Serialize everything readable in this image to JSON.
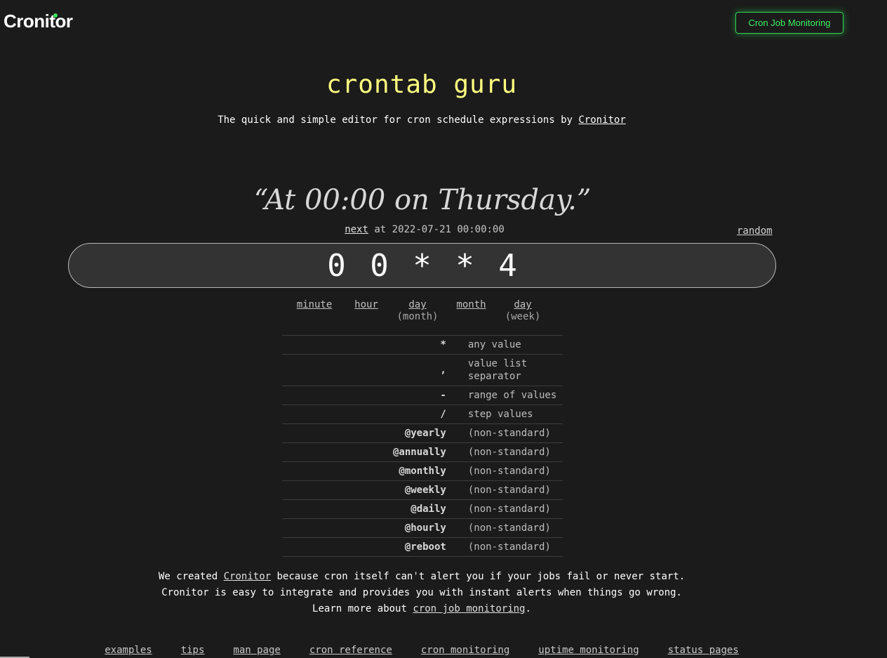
{
  "header": {
    "logo": "Cronitor",
    "cta_label": "Cron Job Monitoring"
  },
  "hero": {
    "title": "crontab guru",
    "subtitle_prefix": "The quick and simple editor for cron schedule expressions by ",
    "subtitle_link": "Cronitor"
  },
  "editor": {
    "human_readable": "“At 00:00 on Thursday.”",
    "next_label": "next",
    "next_text": " at 2022-07-21 00:00:00",
    "random_label": "random",
    "expression": "0 0 * * 4"
  },
  "parts": [
    {
      "label": "minute",
      "sub": ""
    },
    {
      "label": "hour",
      "sub": ""
    },
    {
      "label": "day",
      "sub": "(month)"
    },
    {
      "label": "month",
      "sub": ""
    },
    {
      "label": "day",
      "sub": "(week)"
    }
  ],
  "legend": [
    {
      "symbol": "*",
      "description": "any value"
    },
    {
      "symbol": ",",
      "description": "value list separator"
    },
    {
      "symbol": "-",
      "description": "range of values"
    },
    {
      "symbol": "/",
      "description": "step values"
    },
    {
      "symbol": "@yearly",
      "description": "(non-standard)"
    },
    {
      "symbol": "@annually",
      "description": "(non-standard)"
    },
    {
      "symbol": "@monthly",
      "description": "(non-standard)"
    },
    {
      "symbol": "@weekly",
      "description": "(non-standard)"
    },
    {
      "symbol": "@daily",
      "description": "(non-standard)"
    },
    {
      "symbol": "@hourly",
      "description": "(non-standard)"
    },
    {
      "symbol": "@reboot",
      "description": "(non-standard)"
    }
  ],
  "blurb": {
    "line1_prefix": "We created ",
    "line1_link": "Cronitor",
    "line1_suffix": " because cron itself can't alert you if your jobs fail or never start.",
    "line2": "Cronitor is easy to integrate and provides you with instant alerts when things go wrong.",
    "line3_prefix": "Learn more about ",
    "line3_link": "cron job monitoring",
    "line3_suffix": "."
  },
  "footer": {
    "links": [
      "examples",
      "tips",
      "man page",
      "cron reference",
      "cron monitoring",
      "uptime monitoring",
      "status pages"
    ]
  },
  "colors": {
    "background": "#1b1b1b",
    "accent_green": "#2fd653",
    "title_yellow": "#ffff80"
  }
}
